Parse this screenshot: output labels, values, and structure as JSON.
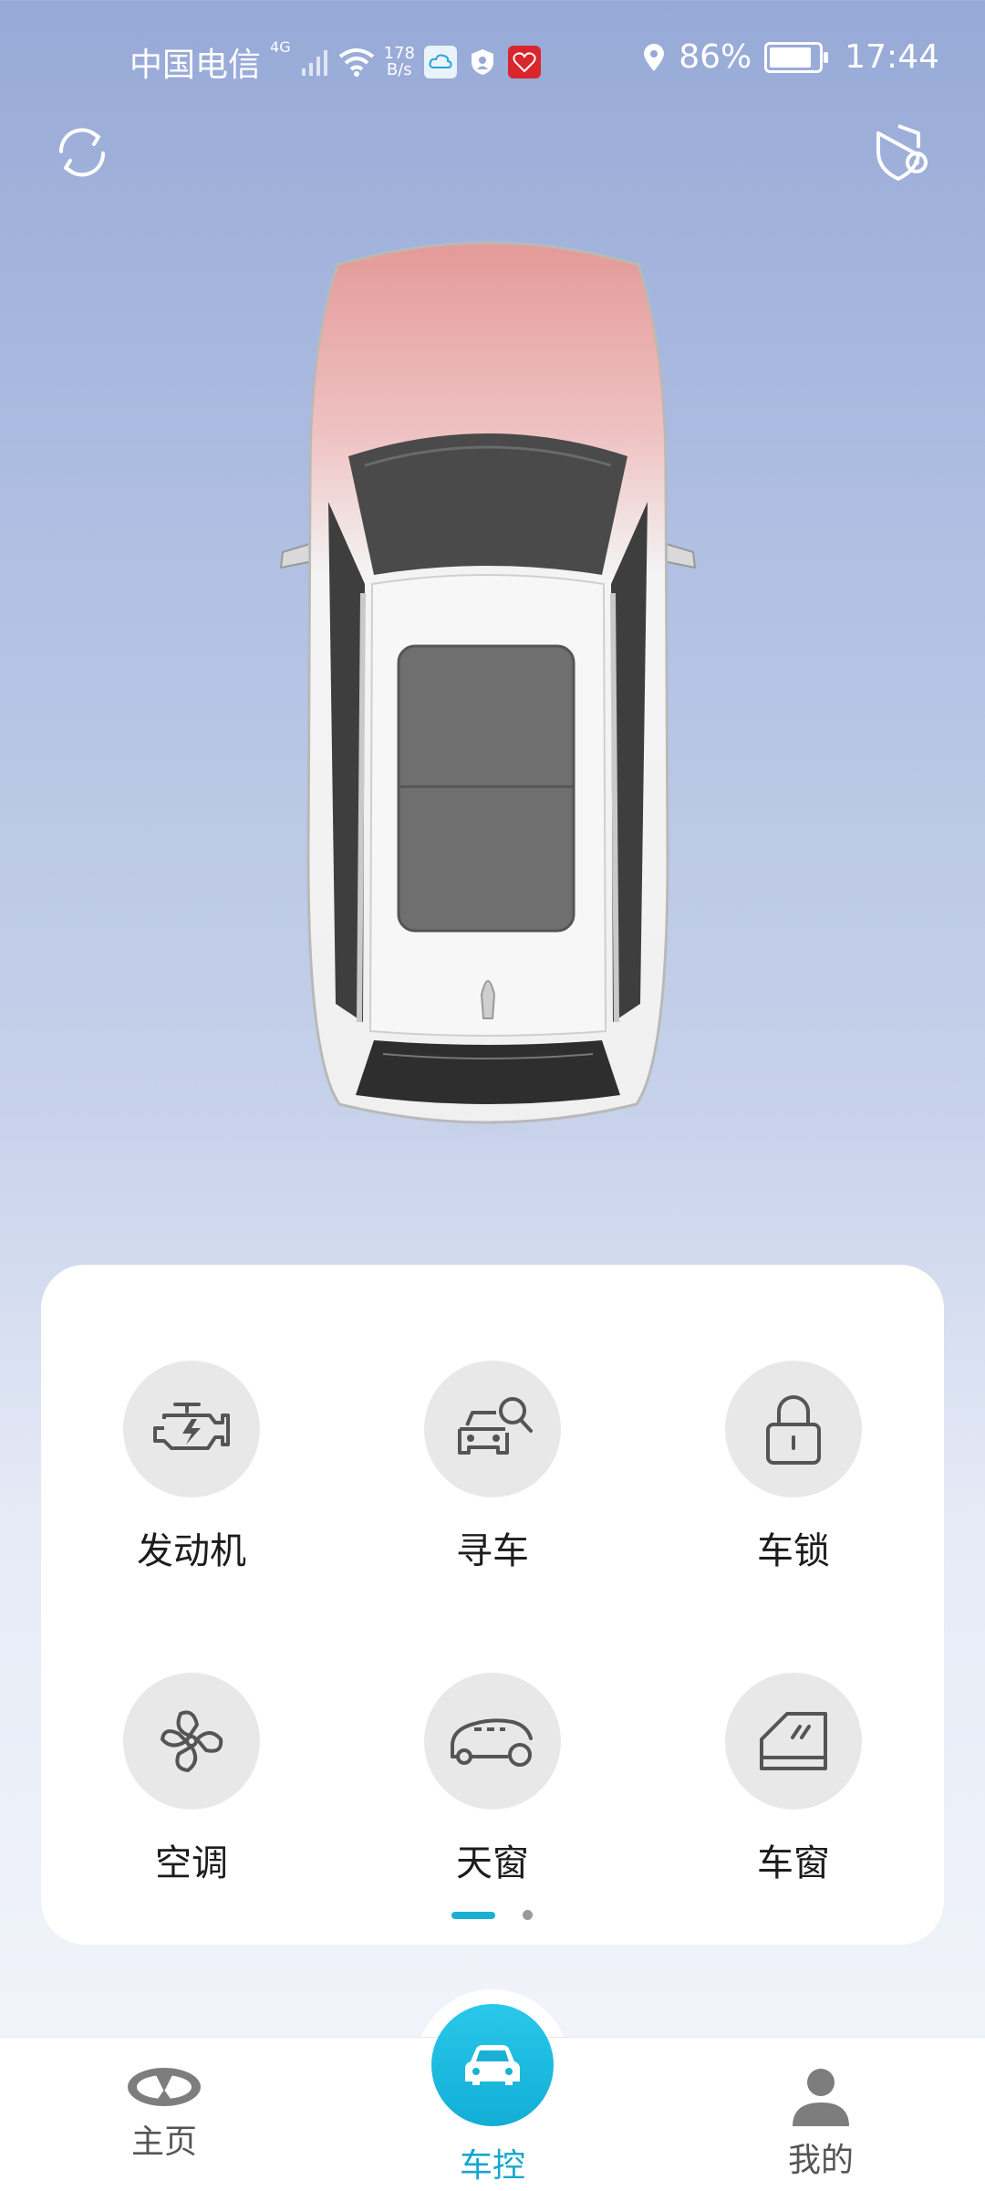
{
  "status_bar": {
    "carrier": "中国电信",
    "network": "4G",
    "speed_value": "178",
    "speed_unit": "B/s",
    "battery": "86%",
    "battery_level": 0.86,
    "time": "17:44"
  },
  "controls": [
    {
      "label": "发动机",
      "icon": "engine-icon"
    },
    {
      "label": "寻车",
      "icon": "find-car-icon"
    },
    {
      "label": "车锁",
      "icon": "lock-icon"
    },
    {
      "label": "空调",
      "icon": "fan-icon"
    },
    {
      "label": "天窗",
      "icon": "sunroof-icon"
    },
    {
      "label": "车窗",
      "icon": "car-window-icon"
    }
  ],
  "pager": {
    "pages": 2,
    "active": 0
  },
  "nav": {
    "home": "主页",
    "control": "车控",
    "mine": "我的"
  },
  "colors": {
    "accent": "#1ab0d6",
    "background_top": "#97a9d6",
    "car_roof_tint": "#e6a3a3"
  }
}
